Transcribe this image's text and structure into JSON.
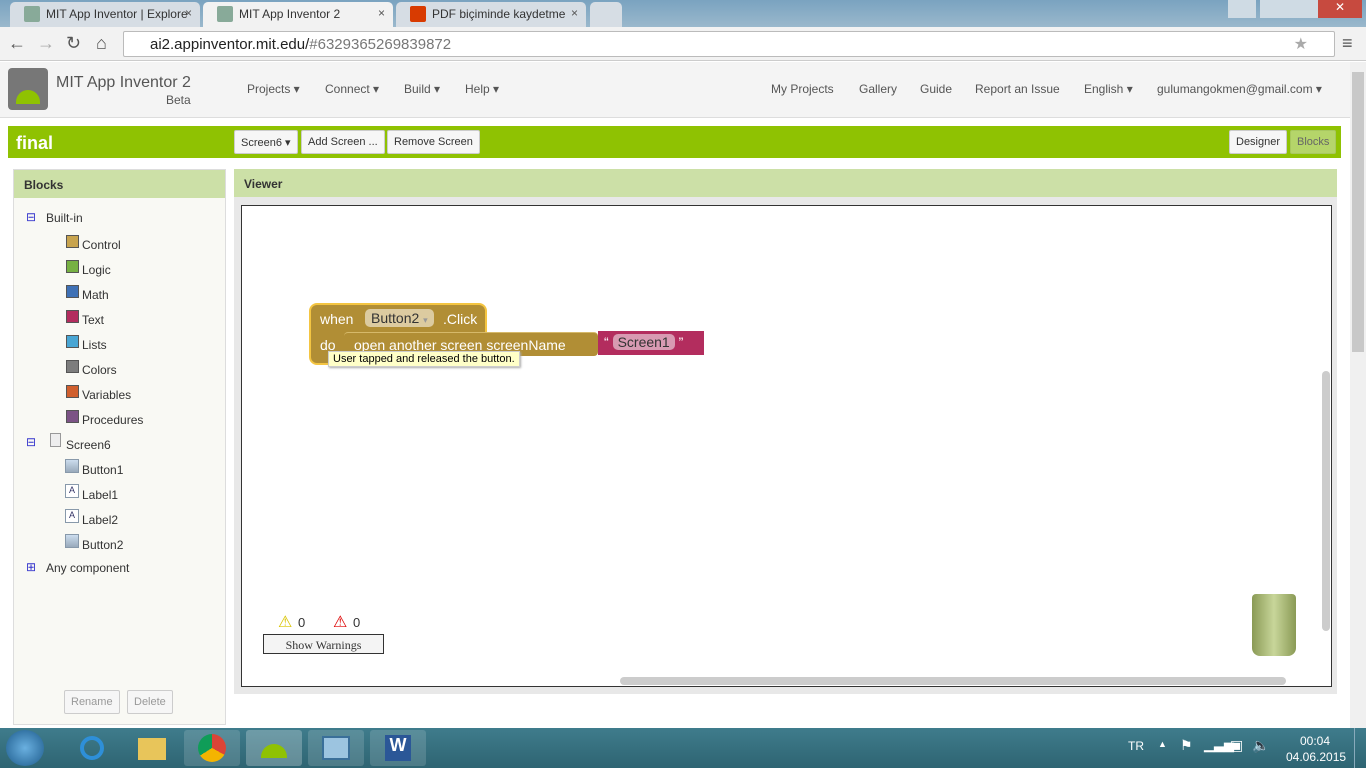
{
  "browser": {
    "tabs": [
      {
        "title": "MIT App Inventor | Explore"
      },
      {
        "title": "MIT App Inventor 2"
      },
      {
        "title": "PDF biçiminde kaydetme"
      }
    ],
    "url_host": "ai2.appinventor.mit.edu/",
    "url_hash": "#6329365269839872"
  },
  "header": {
    "title": "MIT App Inventor 2",
    "subtitle": "Beta",
    "menus": [
      "Projects ▾",
      "Connect ▾",
      "Build ▾",
      "Help ▾"
    ],
    "right_links": [
      "My Projects",
      "Gallery",
      "Guide",
      "Report an Issue",
      "English ▾",
      "gulumangokmen@gmail.com ▾"
    ]
  },
  "project": {
    "name": "final",
    "screen_select": "Screen6 ▾",
    "add_screen": "Add Screen ...",
    "remove_screen": "Remove Screen",
    "designer": "Designer",
    "blocks": "Blocks"
  },
  "blocks_panel": {
    "title": "Blocks",
    "builtin": "Built-in",
    "builtin_items": [
      {
        "label": "Control",
        "color": "#c8a44e"
      },
      {
        "label": "Logic",
        "color": "#77b143"
      },
      {
        "label": "Math",
        "color": "#3f71b5"
      },
      {
        "label": "Text",
        "color": "#b32d5e"
      },
      {
        "label": "Lists",
        "color": "#49a6d4"
      },
      {
        "label": "Colors",
        "color": "#7d7d7d"
      },
      {
        "label": "Variables",
        "color": "#d05f2d"
      },
      {
        "label": "Procedures",
        "color": "#7c5385"
      }
    ],
    "screen": "Screen6",
    "components": [
      "Button1",
      "Label1",
      "Label2",
      "Button2"
    ],
    "any": "Any component",
    "rename": "Rename",
    "delete": "Delete"
  },
  "viewer": {
    "title": "Viewer",
    "block": {
      "when": "when",
      "component": "Button2",
      "event": ".Click",
      "do": "do",
      "action": "open another screen  screenName",
      "text_value": "Screen1",
      "quote_open": "“",
      "quote_close": "”",
      "tooltip": "User tapped and released the button."
    },
    "warnings_count": "0",
    "errors_count": "0",
    "show_warnings": "Show Warnings"
  },
  "taskbar": {
    "lang": "TR",
    "time": "00:04",
    "date": "04.06.2015"
  }
}
